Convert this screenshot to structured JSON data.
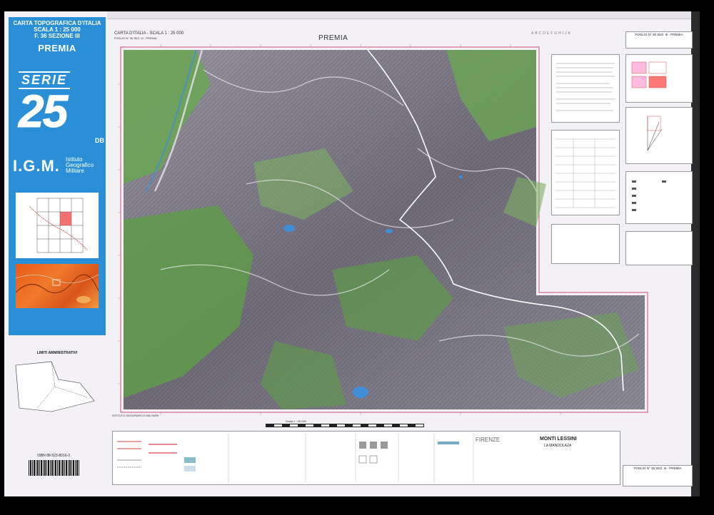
{
  "cover": {
    "line1": "CARTA TOPOGRAFICA D'ITALIA",
    "line2": "SCALA 1 : 25 000",
    "line3": "F. 36 SEZIONE III",
    "title": "PREMIA",
    "serie_label": "SERIE",
    "serie_number": "25",
    "serie_suffix": "DB",
    "igm": "I.G.M.",
    "igm_name": [
      "Istituto",
      "Geografico",
      "Militare"
    ]
  },
  "map": {
    "header_line1": "CARTA D'ITALIA  -  SCALA 1 : 25 000",
    "header_line2": "FOGLIO N° 36 SEZ. III - PREMIA",
    "title": "PREMIA",
    "scale_text": "Scala 1 : 25 000",
    "footer_org": "ISTITUTO GEOGRAFICO MILITARE"
  },
  "admin": {
    "title": "LIMITI AMMINISTRATIVI"
  },
  "isbn": "ISBN 88-523-8016-3",
  "right_panel": {
    "foglio_top": "FOGLIO N° 36 SEZ. III - PREMIA",
    "foglio_bottom": "FOGLIO N° 36 SEZ. III - PREMIA"
  },
  "bottom_legend": {
    "firenze": "FIRENZE",
    "monti_lessini": "MONTI LESSINI",
    "la_mandolaza": "LA MANDOLAZA"
  },
  "colors": {
    "cover_blue": "#2a8fd6",
    "sheet": "#f3f0f6",
    "frame_magenta": "#d0507a",
    "forest": "#5f9a4a",
    "rock": "#8a8592",
    "lake": "#3f8fd8",
    "road": "#ffffff"
  }
}
